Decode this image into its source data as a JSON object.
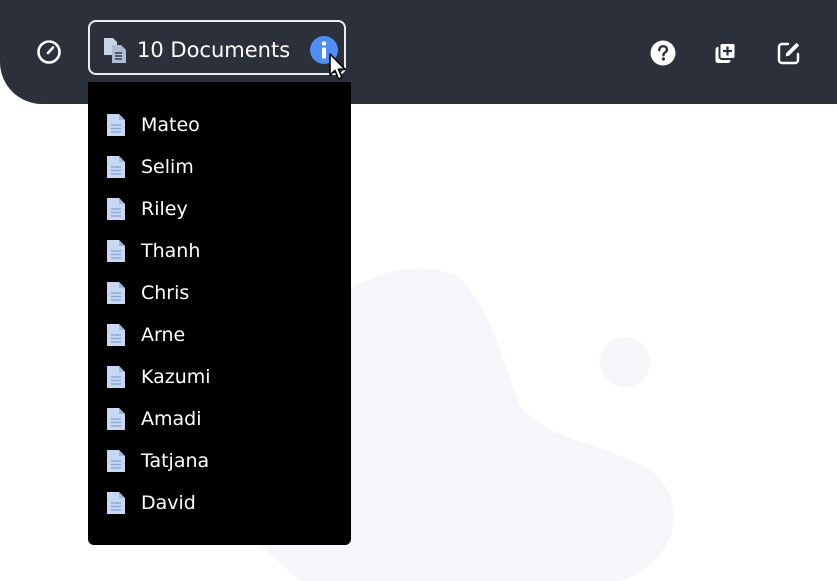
{
  "toolbar": {
    "left_icon": "gauge-icon",
    "right_icons": [
      "help-icon",
      "add-copy-icon",
      "edit-icon"
    ]
  },
  "doc_selector": {
    "label": "10 Documents",
    "icon": "files-icon",
    "info_icon": "info-icon"
  },
  "documents": [
    {
      "name": "Mateo"
    },
    {
      "name": "Selim"
    },
    {
      "name": "Riley"
    },
    {
      "name": "Thanh"
    },
    {
      "name": "Chris"
    },
    {
      "name": "Arne"
    },
    {
      "name": "Kazumi"
    },
    {
      "name": "Amadi"
    },
    {
      "name": "Tatjana"
    },
    {
      "name": "David"
    }
  ],
  "colors": {
    "topbar": "#2b303b",
    "accent": "#4f8ef7",
    "dropdown_bg": "#000000",
    "doc_icon": "#c9d8f2"
  }
}
